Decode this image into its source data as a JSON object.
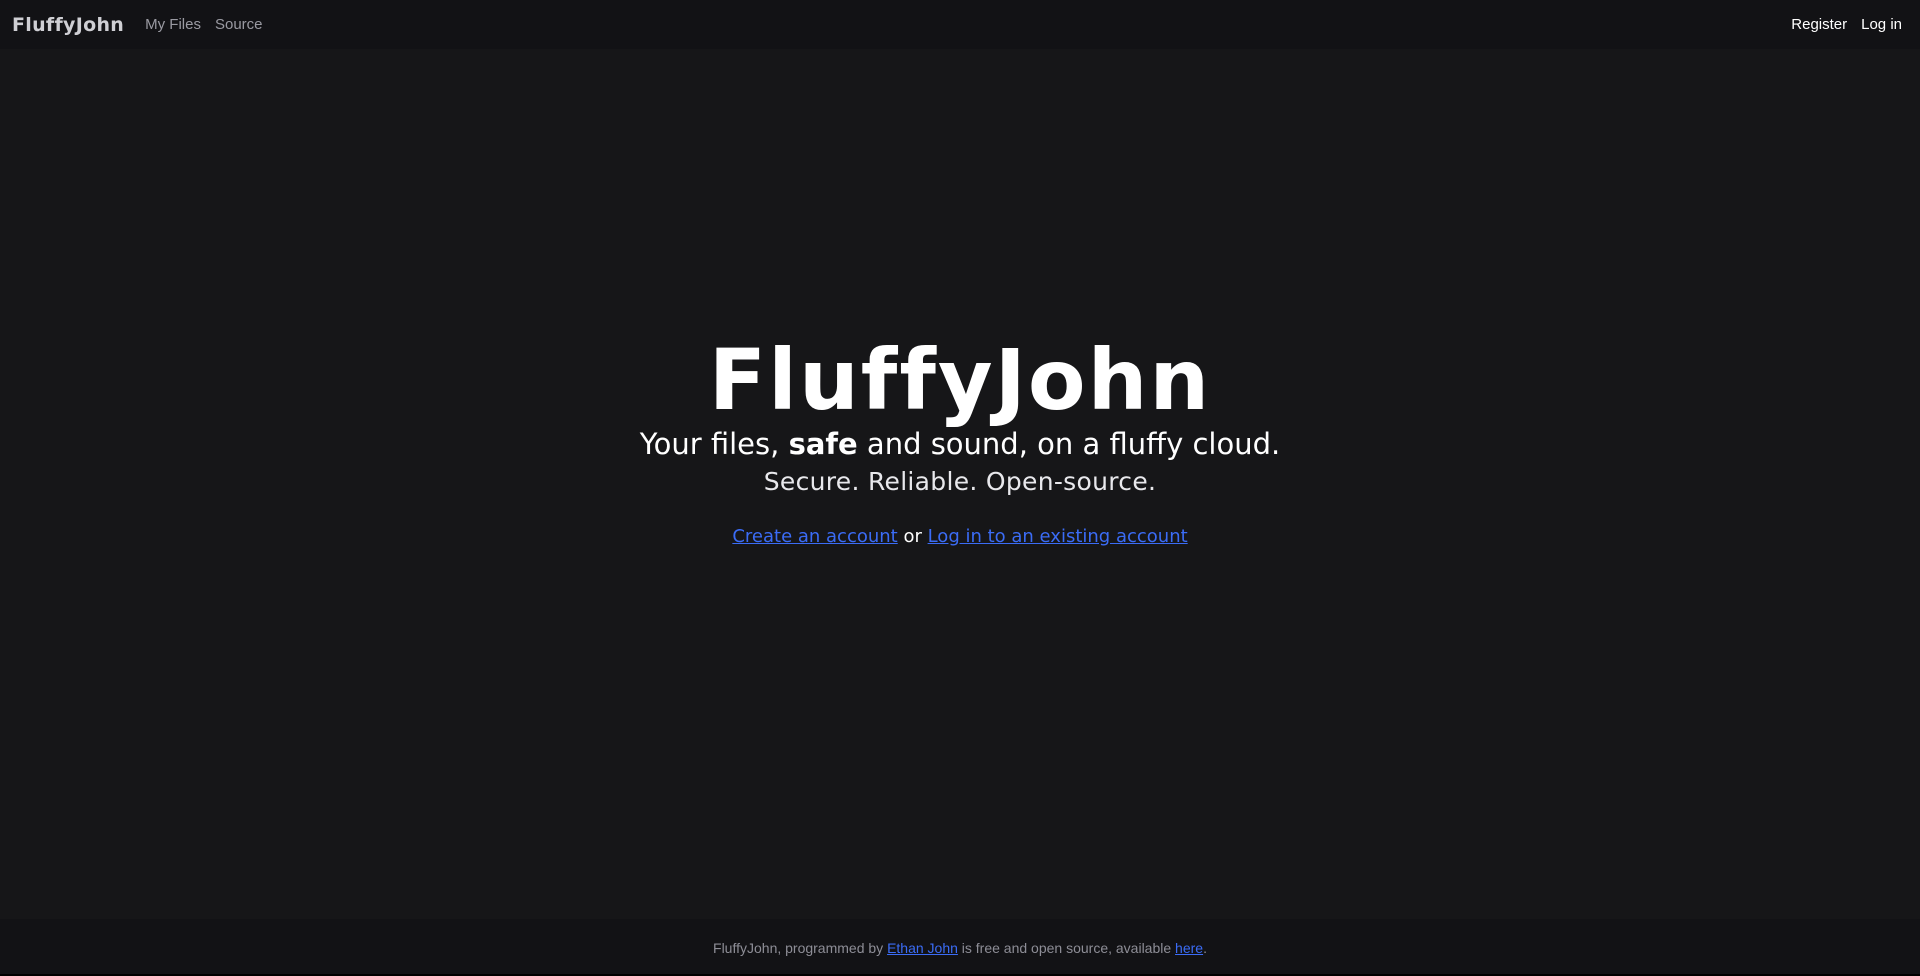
{
  "navbar": {
    "brand": "FluffyJohn",
    "links": [
      "My Files",
      "Source"
    ],
    "right_links": [
      "Register",
      "Log in"
    ]
  },
  "hero": {
    "title": "FluffyJohn",
    "tagline_pre": "Your files, ",
    "tagline_bold": "safe",
    "tagline_post": " and sound, on a fluffy cloud.",
    "subtitle": "Secure. Reliable. Open-source.",
    "cta_create": "Create an account",
    "cta_or": " or ",
    "cta_login": "Log in to an existing account"
  },
  "footer": {
    "text_pre": "FluffyJohn, programmed by ",
    "author_link": "Ethan John",
    "text_mid": " is free and open source, available ",
    "here_link": "here",
    "text_post": "."
  },
  "colors": {
    "background": "#161618",
    "navbar": "#121215",
    "link": "#3b6cf6"
  }
}
